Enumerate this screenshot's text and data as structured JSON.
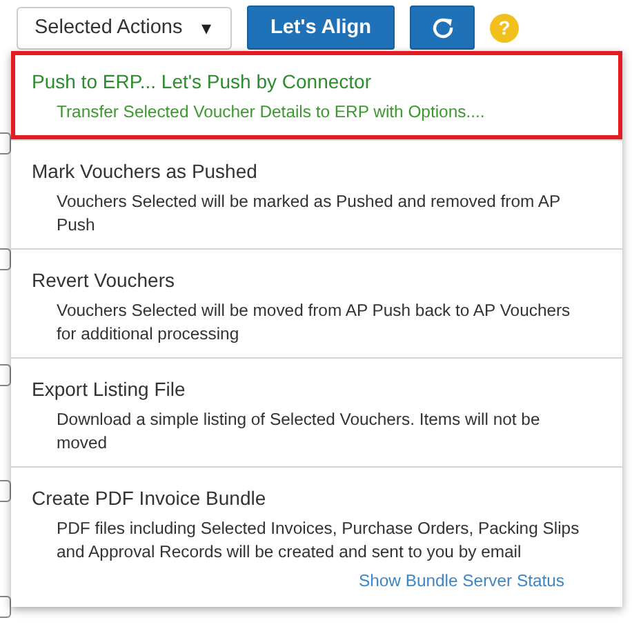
{
  "toolbar": {
    "dropdown": {
      "label": "Selected Actions",
      "caret": "▾"
    },
    "buttons": [
      {
        "kind": "text",
        "label": "Let's Align"
      },
      {
        "kind": "refresh"
      }
    ],
    "help": "?"
  },
  "background_rows": [
    {
      "checked": false
    },
    {
      "checked": false
    },
    {
      "checked": false
    },
    {
      "checked": false
    },
    {
      "checked": false
    }
  ],
  "menu": {
    "items": [
      {
        "title": "Push to ERP... Let's Push by Connector",
        "description": "Transfer Selected Voucher Details to ERP with Options....",
        "selected": true
      },
      {
        "title": "Mark Vouchers as Pushed",
        "description": "Vouchers Selected will be marked as Pushed and removed from AP Push",
        "selected": false
      },
      {
        "title": "Revert Vouchers",
        "description": "Vouchers Selected will be moved from AP Push back to AP Vouchers for additional processing",
        "selected": false
      },
      {
        "title": "Export Listing File",
        "description": "Download a simple listing of Selected Vouchers. Items will not be moved",
        "selected": false
      },
      {
        "title": "Create PDF Invoice Bundle",
        "description": "PDF files including Selected Invoices, Purchase Orders, Packing Slips and Approval Records will be created and sent to you by email",
        "selected": false,
        "link": "Show Bundle Server Status"
      }
    ]
  }
}
